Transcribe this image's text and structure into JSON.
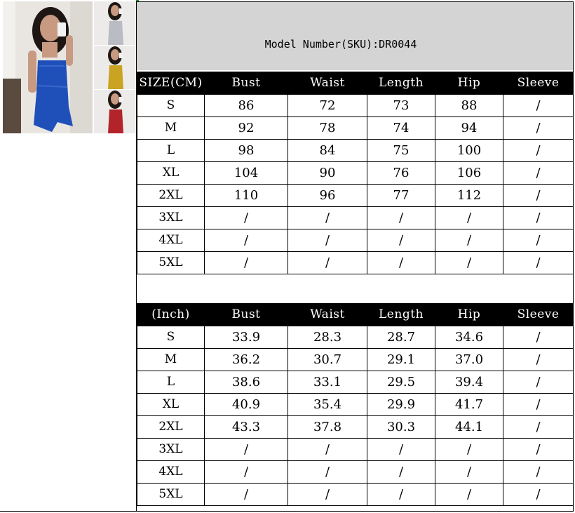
{
  "sku_label": "Model Number(SKU):DR0044",
  "cm_table": {
    "headers": [
      "SIZE(CM)",
      "Bust",
      "Waist",
      "Length",
      "Hip",
      "Sleeve"
    ],
    "rows": [
      [
        "S",
        "86",
        "72",
        "73",
        "88",
        "/"
      ],
      [
        "M",
        "92",
        "78",
        "74",
        "94",
        "/"
      ],
      [
        "L",
        "98",
        "84",
        "75",
        "100",
        "/"
      ],
      [
        "XL",
        "104",
        "90",
        "76",
        "106",
        "/"
      ],
      [
        "2XL",
        "110",
        "96",
        "77",
        "112",
        "/"
      ],
      [
        "3XL",
        "/",
        "/",
        "/",
        "/",
        "/"
      ],
      [
        "4XL",
        "/",
        "/",
        "/",
        "/",
        "/"
      ],
      [
        "5XL",
        "/",
        "/",
        "/",
        "/",
        "/"
      ]
    ]
  },
  "inch_table": {
    "headers": [
      "(Inch)",
      "Bust",
      "Waist",
      "Length",
      "Hip",
      "Sleeve"
    ],
    "rows": [
      [
        "S",
        "33.9",
        "28.3",
        "28.7",
        "34.6",
        "/"
      ],
      [
        "M",
        "36.2",
        "30.7",
        "29.1",
        "37.0",
        "/"
      ],
      [
        "L",
        "38.6",
        "33.1",
        "29.5",
        "39.4",
        "/"
      ],
      [
        "XL",
        "40.9",
        "35.4",
        "29.9",
        "41.7",
        "/"
      ],
      [
        "2XL",
        "43.3",
        "37.8",
        "30.3",
        "44.1",
        "/"
      ],
      [
        "3XL",
        "/",
        "/",
        "/",
        "/",
        "/"
      ],
      [
        "4XL",
        "/",
        "/",
        "/",
        "/",
        "/"
      ],
      [
        "5XL",
        "/",
        "/",
        "/",
        "/",
        "/"
      ]
    ]
  },
  "colors": {
    "dress_blue": "#1f4fb8",
    "dress_grey": "#b9bcc2",
    "dress_yellow": "#c9a321",
    "dress_red": "#b3242a",
    "header_bg": "#000000",
    "sku_bg": "#d4d4d4"
  }
}
